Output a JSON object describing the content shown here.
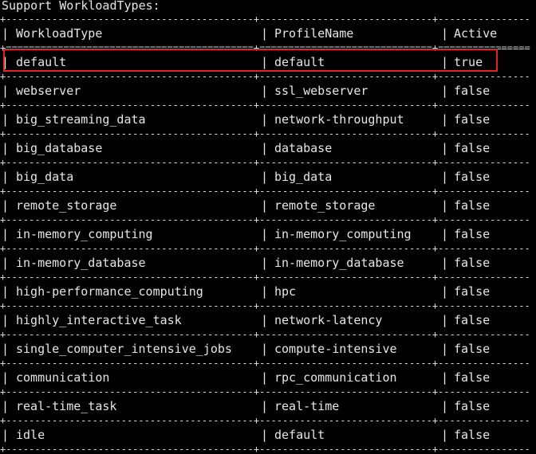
{
  "terminal": {
    "title": "Support WorkloadTypes:",
    "separator_dash": "+-------------------------------------------+------------------------------+----------------",
    "separator_equal": "+===========================================+==============================+================",
    "headers": {
      "workload_type": "WorkloadType",
      "profile_name": "ProfileName",
      "active": "Active"
    },
    "rows": [
      {
        "workload_type": "default",
        "profile_name": "default",
        "active": "true"
      },
      {
        "workload_type": "webserver",
        "profile_name": "ssl_webserver",
        "active": "false"
      },
      {
        "workload_type": "big_streaming_data",
        "profile_name": "network-throughput",
        "active": "false"
      },
      {
        "workload_type": "big_database",
        "profile_name": "database",
        "active": "false"
      },
      {
        "workload_type": "big_data",
        "profile_name": "big_data",
        "active": "false"
      },
      {
        "workload_type": "remote_storage",
        "profile_name": "remote_storage",
        "active": "false"
      },
      {
        "workload_type": "in-memory_computing",
        "profile_name": "in-memory_computing",
        "active": "false"
      },
      {
        "workload_type": "in-memory_database",
        "profile_name": "in-memory_database",
        "active": "false"
      },
      {
        "workload_type": "high-performance_computing",
        "profile_name": "hpc",
        "active": "false"
      },
      {
        "workload_type": "highly_interactive_task",
        "profile_name": "network-latency",
        "active": "false"
      },
      {
        "workload_type": "single_computer_intensive_jobs",
        "profile_name": "compute-intensive",
        "active": "false"
      },
      {
        "workload_type": "communication",
        "profile_name": "rpc_communication",
        "active": "false"
      },
      {
        "workload_type": "real-time_task",
        "profile_name": "real-time",
        "active": "false"
      },
      {
        "workload_type": "idle",
        "profile_name": "default",
        "active": "false"
      }
    ],
    "highlight_color": "#e02424",
    "text_color": "#e6e6e6",
    "background_color": "#000000"
  }
}
